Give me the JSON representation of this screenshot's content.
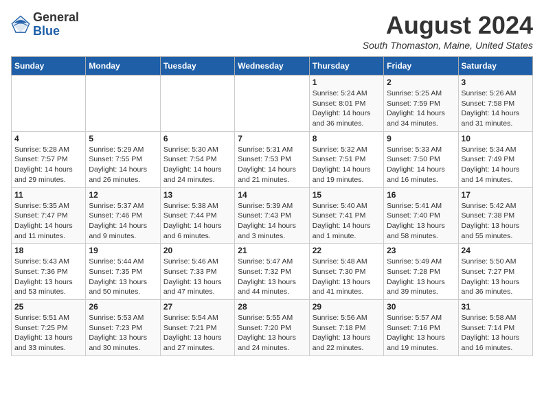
{
  "logo": {
    "general": "General",
    "blue": "Blue"
  },
  "title": {
    "month_year": "August 2024",
    "location": "South Thomaston, Maine, United States"
  },
  "weekdays": [
    "Sunday",
    "Monday",
    "Tuesday",
    "Wednesday",
    "Thursday",
    "Friday",
    "Saturday"
  ],
  "weeks": [
    [
      {
        "day": "",
        "info": ""
      },
      {
        "day": "",
        "info": ""
      },
      {
        "day": "",
        "info": ""
      },
      {
        "day": "",
        "info": ""
      },
      {
        "day": "1",
        "info": "Sunrise: 5:24 AM\nSunset: 8:01 PM\nDaylight: 14 hours and 36 minutes."
      },
      {
        "day": "2",
        "info": "Sunrise: 5:25 AM\nSunset: 7:59 PM\nDaylight: 14 hours and 34 minutes."
      },
      {
        "day": "3",
        "info": "Sunrise: 5:26 AM\nSunset: 7:58 PM\nDaylight: 14 hours and 31 minutes."
      }
    ],
    [
      {
        "day": "4",
        "info": "Sunrise: 5:28 AM\nSunset: 7:57 PM\nDaylight: 14 hours and 29 minutes."
      },
      {
        "day": "5",
        "info": "Sunrise: 5:29 AM\nSunset: 7:55 PM\nDaylight: 14 hours and 26 minutes."
      },
      {
        "day": "6",
        "info": "Sunrise: 5:30 AM\nSunset: 7:54 PM\nDaylight: 14 hours and 24 minutes."
      },
      {
        "day": "7",
        "info": "Sunrise: 5:31 AM\nSunset: 7:53 PM\nDaylight: 14 hours and 21 minutes."
      },
      {
        "day": "8",
        "info": "Sunrise: 5:32 AM\nSunset: 7:51 PM\nDaylight: 14 hours and 19 minutes."
      },
      {
        "day": "9",
        "info": "Sunrise: 5:33 AM\nSunset: 7:50 PM\nDaylight: 14 hours and 16 minutes."
      },
      {
        "day": "10",
        "info": "Sunrise: 5:34 AM\nSunset: 7:49 PM\nDaylight: 14 hours and 14 minutes."
      }
    ],
    [
      {
        "day": "11",
        "info": "Sunrise: 5:35 AM\nSunset: 7:47 PM\nDaylight: 14 hours and 11 minutes."
      },
      {
        "day": "12",
        "info": "Sunrise: 5:37 AM\nSunset: 7:46 PM\nDaylight: 14 hours and 9 minutes."
      },
      {
        "day": "13",
        "info": "Sunrise: 5:38 AM\nSunset: 7:44 PM\nDaylight: 14 hours and 6 minutes."
      },
      {
        "day": "14",
        "info": "Sunrise: 5:39 AM\nSunset: 7:43 PM\nDaylight: 14 hours and 3 minutes."
      },
      {
        "day": "15",
        "info": "Sunrise: 5:40 AM\nSunset: 7:41 PM\nDaylight: 14 hours and 1 minute."
      },
      {
        "day": "16",
        "info": "Sunrise: 5:41 AM\nSunset: 7:40 PM\nDaylight: 13 hours and 58 minutes."
      },
      {
        "day": "17",
        "info": "Sunrise: 5:42 AM\nSunset: 7:38 PM\nDaylight: 13 hours and 55 minutes."
      }
    ],
    [
      {
        "day": "18",
        "info": "Sunrise: 5:43 AM\nSunset: 7:36 PM\nDaylight: 13 hours and 53 minutes."
      },
      {
        "day": "19",
        "info": "Sunrise: 5:44 AM\nSunset: 7:35 PM\nDaylight: 13 hours and 50 minutes."
      },
      {
        "day": "20",
        "info": "Sunrise: 5:46 AM\nSunset: 7:33 PM\nDaylight: 13 hours and 47 minutes."
      },
      {
        "day": "21",
        "info": "Sunrise: 5:47 AM\nSunset: 7:32 PM\nDaylight: 13 hours and 44 minutes."
      },
      {
        "day": "22",
        "info": "Sunrise: 5:48 AM\nSunset: 7:30 PM\nDaylight: 13 hours and 41 minutes."
      },
      {
        "day": "23",
        "info": "Sunrise: 5:49 AM\nSunset: 7:28 PM\nDaylight: 13 hours and 39 minutes."
      },
      {
        "day": "24",
        "info": "Sunrise: 5:50 AM\nSunset: 7:27 PM\nDaylight: 13 hours and 36 minutes."
      }
    ],
    [
      {
        "day": "25",
        "info": "Sunrise: 5:51 AM\nSunset: 7:25 PM\nDaylight: 13 hours and 33 minutes."
      },
      {
        "day": "26",
        "info": "Sunrise: 5:53 AM\nSunset: 7:23 PM\nDaylight: 13 hours and 30 minutes."
      },
      {
        "day": "27",
        "info": "Sunrise: 5:54 AM\nSunset: 7:21 PM\nDaylight: 13 hours and 27 minutes."
      },
      {
        "day": "28",
        "info": "Sunrise: 5:55 AM\nSunset: 7:20 PM\nDaylight: 13 hours and 24 minutes."
      },
      {
        "day": "29",
        "info": "Sunrise: 5:56 AM\nSunset: 7:18 PM\nDaylight: 13 hours and 22 minutes."
      },
      {
        "day": "30",
        "info": "Sunrise: 5:57 AM\nSunset: 7:16 PM\nDaylight: 13 hours and 19 minutes."
      },
      {
        "day": "31",
        "info": "Sunrise: 5:58 AM\nSunset: 7:14 PM\nDaylight: 13 hours and 16 minutes."
      }
    ]
  ]
}
